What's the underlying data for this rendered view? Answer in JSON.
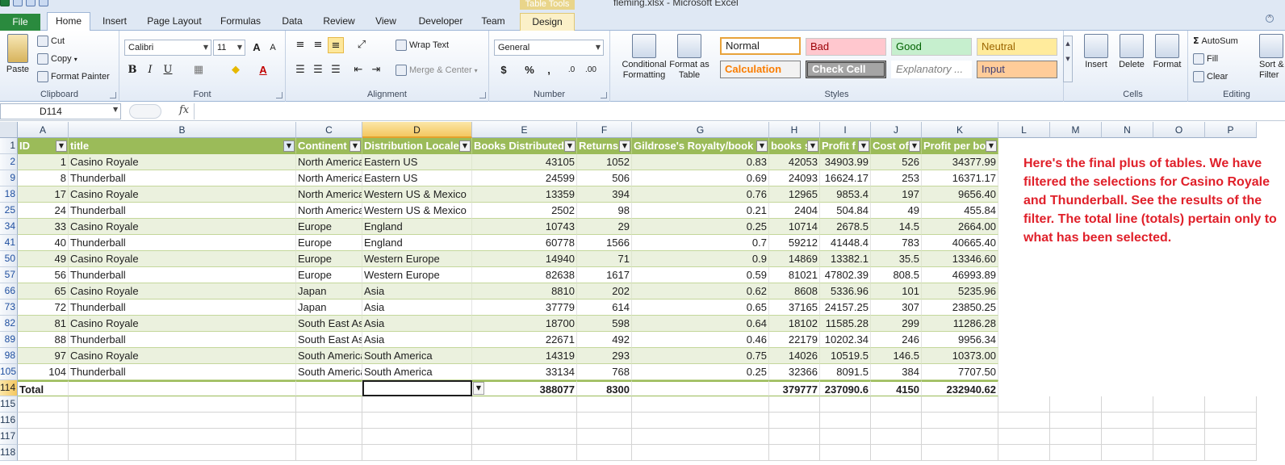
{
  "window": {
    "title": "fleming.xlsx - Microsoft Excel",
    "context_tab_group": "Table Tools"
  },
  "ribbon_tabs": [
    "File",
    "Home",
    "Insert",
    "Page Layout",
    "Formulas",
    "Data",
    "Review",
    "View",
    "Developer",
    "Team",
    "Design"
  ],
  "clipboard": {
    "paste": "Paste",
    "cut": "Cut",
    "copy": "Copy",
    "format_painter": "Format Painter",
    "label": "Clipboard"
  },
  "font": {
    "name": "Calibri",
    "size": "11",
    "bold": "B",
    "italic": "I",
    "underline": "U",
    "grow": "A",
    "shrink": "A",
    "label": "Font"
  },
  "alignment": {
    "wrap_text": "Wrap Text",
    "merge_center": "Merge & Center",
    "label": "Alignment"
  },
  "number": {
    "format": "General",
    "currency": "$",
    "percent": "%",
    "comma": ",",
    "inc_decimal": ".0",
    "dec_decimal": ".00",
    "label": "Number"
  },
  "styles": {
    "conditional": "Conditional Formatting",
    "format_table": "Format as Table",
    "gallery": [
      "Normal",
      "Bad",
      "Good",
      "Neutral",
      "Calculation",
      "Check Cell",
      "Explanatory ...",
      "Input"
    ],
    "label": "Styles"
  },
  "cells": {
    "insert": "Insert",
    "delete": "Delete",
    "format": "Format",
    "label": "Cells"
  },
  "editing": {
    "autosum": "AutoSum",
    "fill": "Fill",
    "clear": "Clear",
    "sort": "Sort &",
    "filter": "Filter",
    "label": "Editing"
  },
  "formula_bar": {
    "name_box": "D114",
    "fx": "fx",
    "formula": ""
  },
  "columns": [
    {
      "letter": "A",
      "w": 63
    },
    {
      "letter": "B",
      "w": 282
    },
    {
      "letter": "C",
      "w": 82
    },
    {
      "letter": "D",
      "w": 136
    },
    {
      "letter": "E",
      "w": 130
    },
    {
      "letter": "F",
      "w": 68
    },
    {
      "letter": "G",
      "w": 170
    },
    {
      "letter": "H",
      "w": 63
    },
    {
      "letter": "I",
      "w": 63
    },
    {
      "letter": "J",
      "w": 63
    },
    {
      "letter": "K",
      "w": 95
    },
    {
      "letter": "L",
      "w": 64
    },
    {
      "letter": "M",
      "w": 64
    },
    {
      "letter": "N",
      "w": 64
    },
    {
      "letter": "O",
      "w": 64
    },
    {
      "letter": "P",
      "w": 64
    }
  ],
  "selected_column": "D",
  "table": {
    "headers": [
      "ID",
      "title",
      "Continent",
      "Distribution Locale",
      "Books Distributed",
      "Returns",
      "Gildrose's Royalty/book",
      "books s",
      "Profit f",
      "Cost of",
      "Profit per bo"
    ],
    "filtered_column": "title",
    "rows": [
      {
        "rownum": "2",
        "cells": [
          "1",
          "Casino Royale",
          "North America",
          "Eastern US",
          "43105",
          "1052",
          "0.83",
          "42053",
          "34903.99",
          "526",
          "34377.99"
        ]
      },
      {
        "rownum": "9",
        "cells": [
          "8",
          "Thunderball",
          "North America",
          "Eastern US",
          "24599",
          "506",
          "0.69",
          "24093",
          "16624.17",
          "253",
          "16371.17"
        ]
      },
      {
        "rownum": "18",
        "cells": [
          "17",
          "Casino Royale",
          "North America",
          "Western US & Mexico",
          "13359",
          "394",
          "0.76",
          "12965",
          "9853.4",
          "197",
          "9656.40"
        ]
      },
      {
        "rownum": "25",
        "cells": [
          "24",
          "Thunderball",
          "North America",
          "Western US & Mexico",
          "2502",
          "98",
          "0.21",
          "2404",
          "504.84",
          "49",
          "455.84"
        ]
      },
      {
        "rownum": "34",
        "cells": [
          "33",
          "Casino Royale",
          "Europe",
          "England",
          "10743",
          "29",
          "0.25",
          "10714",
          "2678.5",
          "14.5",
          "2664.00"
        ]
      },
      {
        "rownum": "41",
        "cells": [
          "40",
          "Thunderball",
          "Europe",
          "England",
          "60778",
          "1566",
          "0.7",
          "59212",
          "41448.4",
          "783",
          "40665.40"
        ]
      },
      {
        "rownum": "50",
        "cells": [
          "49",
          "Casino Royale",
          "Europe",
          "Western Europe",
          "14940",
          "71",
          "0.9",
          "14869",
          "13382.1",
          "35.5",
          "13346.60"
        ]
      },
      {
        "rownum": "57",
        "cells": [
          "56",
          "Thunderball",
          "Europe",
          "Western Europe",
          "82638",
          "1617",
          "0.59",
          "81021",
          "47802.39",
          "808.5",
          "46993.89"
        ]
      },
      {
        "rownum": "66",
        "cells": [
          "65",
          "Casino Royale",
          "Japan",
          "Asia",
          "8810",
          "202",
          "0.62",
          "8608",
          "5336.96",
          "101",
          "5235.96"
        ]
      },
      {
        "rownum": "73",
        "cells": [
          "72",
          "Thunderball",
          "Japan",
          "Asia",
          "37779",
          "614",
          "0.65",
          "37165",
          "24157.25",
          "307",
          "23850.25"
        ]
      },
      {
        "rownum": "82",
        "cells": [
          "81",
          "Casino Royale",
          "South East Asia",
          "Asia",
          "18700",
          "598",
          "0.64",
          "18102",
          "11585.28",
          "299",
          "11286.28"
        ]
      },
      {
        "rownum": "89",
        "cells": [
          "88",
          "Thunderball",
          "South East Asia",
          "Asia",
          "22671",
          "492",
          "0.46",
          "22179",
          "10202.34",
          "246",
          "9956.34"
        ]
      },
      {
        "rownum": "98",
        "cells": [
          "97",
          "Casino Royale",
          "South America",
          "South America",
          "14319",
          "293",
          "0.75",
          "14026",
          "10519.5",
          "146.5",
          "10373.00"
        ]
      },
      {
        "rownum": "105",
        "cells": [
          "104",
          "Thunderball",
          "South America",
          "South America",
          "33134",
          "768",
          "0.25",
          "32366",
          "8091.5",
          "384",
          "7707.50"
        ]
      }
    ],
    "total_row": {
      "rownum": "114",
      "cells": [
        "Total",
        "",
        "",
        "",
        "388077",
        "8300",
        "",
        "379777",
        "237090.6",
        "4150",
        "232940.62"
      ]
    }
  },
  "empty_rows": [
    "115",
    "116",
    "117",
    "118"
  ],
  "note": "Here's the final plus of tables. We have filtered the selections for Casino Royale and Thunderball. See the results of the filter. The total line (totals) pertain only to what has been selected.",
  "colors": {
    "table_header": "#9bbb59",
    "band": "#ebf1de",
    "note": "#e0202a",
    "file_tab": "#2a8a3e"
  }
}
